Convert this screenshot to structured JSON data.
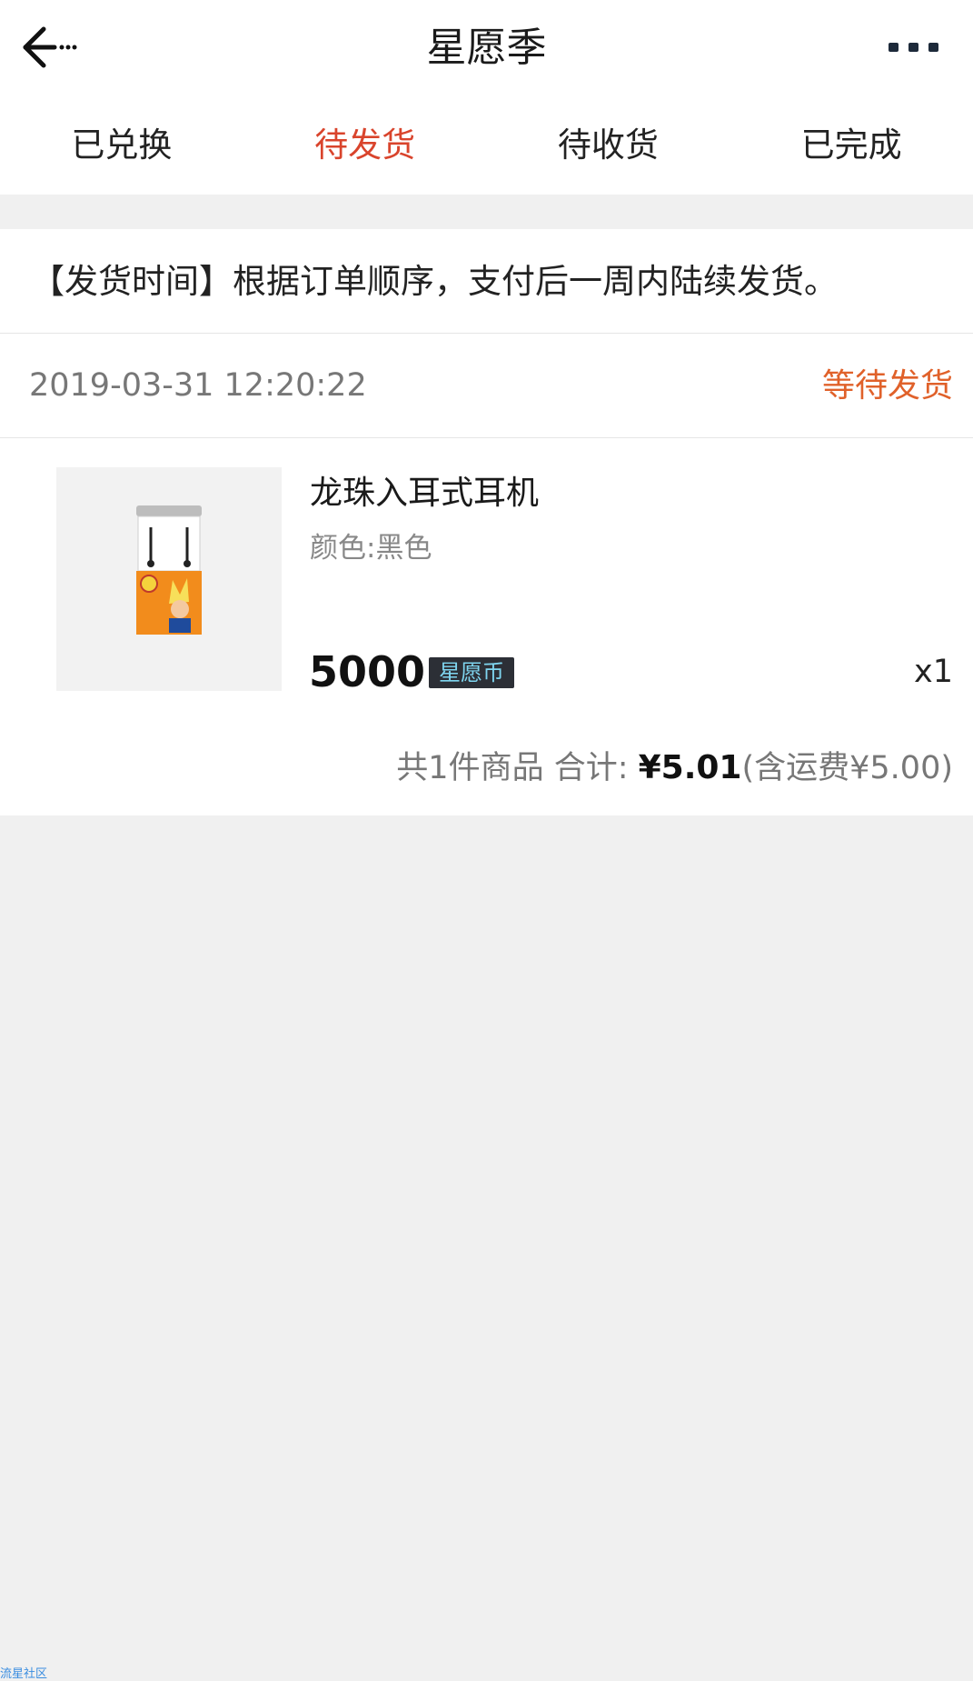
{
  "nav": {
    "title": "星愿季"
  },
  "tabs": [
    {
      "label": "已兑换"
    },
    {
      "label": "待发货"
    },
    {
      "label": "待收货"
    },
    {
      "label": "已完成"
    }
  ],
  "active_tab": "待发货",
  "notice": "【发货时间】根据订单顺序，支付后一周内陆续发货。",
  "order": {
    "time": "2019-03-31 12:20:22",
    "status": "等待发货",
    "product": {
      "name": "龙珠入耳式耳机",
      "spec": "颜色:黑色",
      "price": "5000",
      "currency": "星愿币",
      "qty": "x1"
    },
    "summary": {
      "count_text": "共1件商品 合计: ",
      "amount": "¥5.01",
      "shipping": "(含运费¥5.00)"
    }
  },
  "watermark": "流星社区",
  "colors": {
    "accent": "#d9442c",
    "status": "#e0612a",
    "background": "#f0f0f0"
  },
  "icons": {
    "back": "back-arrow-icon",
    "more": "more-dots-icon"
  }
}
